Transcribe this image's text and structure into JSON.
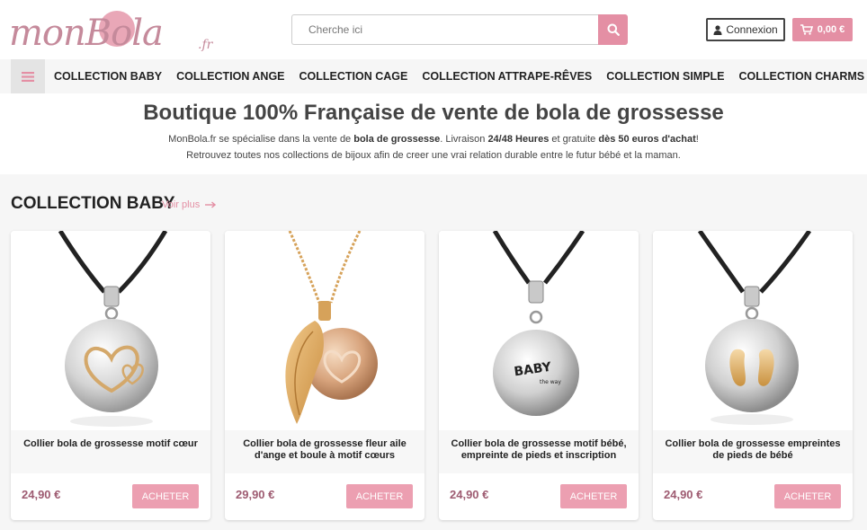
{
  "header": {
    "logo_text": "monBola",
    "logo_suffix": ".fr",
    "search_placeholder": "Cherche ici",
    "login_label": "Connexion",
    "cart_total": "0,00 €"
  },
  "nav": {
    "items": [
      {
        "label": "COLLECTION BABY"
      },
      {
        "label": "COLLECTION ANGE"
      },
      {
        "label": "COLLECTION CAGE"
      },
      {
        "label": "COLLECTION ATTRAPE-RÊVES"
      },
      {
        "label": "COLLECTION SIMPLE"
      },
      {
        "label": "COLLECTION CHARMS"
      }
    ]
  },
  "intro": {
    "title": "Boutique 100% Française de vente de bola de grossesse",
    "line1_a": "MonBola.fr se spécialise dans la vente de ",
    "line1_b": "bola de grossesse",
    "line1_c": ". Livraison ",
    "line1_d": "24/48 Heures",
    "line1_e": " et gratuite ",
    "line1_f": "dès 50 euros d'achat",
    "line1_g": "!",
    "line2": "Retrouvez toutes nos collections de bijoux afin de creer une vrai relation durable entre le futur bébé et la maman."
  },
  "section": {
    "title": "COLLECTION BABY",
    "view_more": "Voir plus"
  },
  "products": [
    {
      "name": "Collier bola de grossesse motif cœur",
      "price": "24,90 €",
      "buy_label": "ACHETER"
    },
    {
      "name": "Collier bola de grossesse fleur aile d'ange et boule à motif cœurs",
      "price": "29,90 €",
      "buy_label": "ACHETER"
    },
    {
      "name": "Collier bola de grossesse motif bébé, empreinte de pieds et inscription",
      "price": "24,90 €",
      "buy_label": "ACHETER"
    },
    {
      "name": "Collier bola de grossesse empreintes de pieds de bébé",
      "price": "24,90 €",
      "buy_label": "ACHETER"
    }
  ],
  "product_images": {
    "baby_ball_text": "BABY",
    "baby_ball_subtext": "the way"
  },
  "colors": {
    "accent": "#e48fa4",
    "price": "#9e5b71"
  }
}
